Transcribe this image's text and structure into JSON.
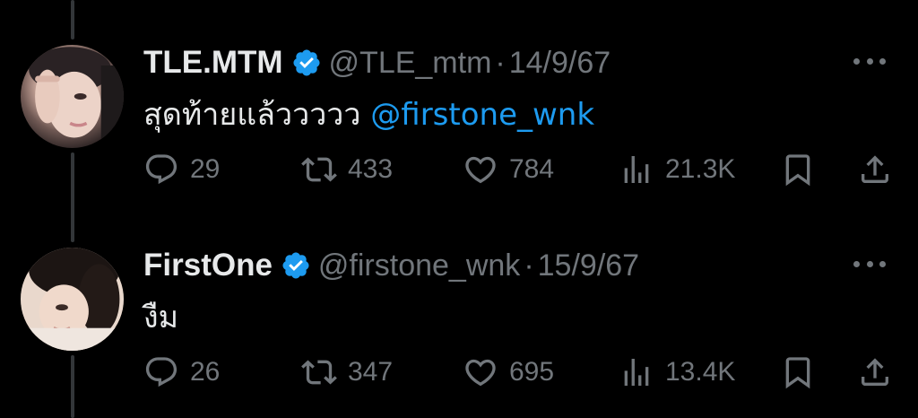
{
  "tweets": [
    {
      "name": "TLE.MTM",
      "handle": "@TLE_mtm",
      "separator": "·",
      "date": "14/9/67",
      "text_before": "สุดท้ายแล้ววววว ",
      "mention": "@firstone_wnk",
      "replies": "29",
      "retweets": "433",
      "likes": "784",
      "views": "21.3K"
    },
    {
      "name": "FirstOne",
      "handle": "@firstone_wnk",
      "separator": "·",
      "date": "15/9/67",
      "text_before": "งืม",
      "mention": "",
      "replies": "26",
      "retweets": "347",
      "likes": "695",
      "views": "13.4K"
    }
  ],
  "colors": {
    "background": "#000000",
    "text": "#e7e9ea",
    "secondary": "#71767b",
    "accent": "#1d9bf0",
    "thread_line": "#333639"
  },
  "icons": [
    "verified-badge-icon",
    "more-icon",
    "reply-icon",
    "retweet-icon",
    "like-icon",
    "views-icon",
    "bookmark-icon",
    "share-icon"
  ]
}
